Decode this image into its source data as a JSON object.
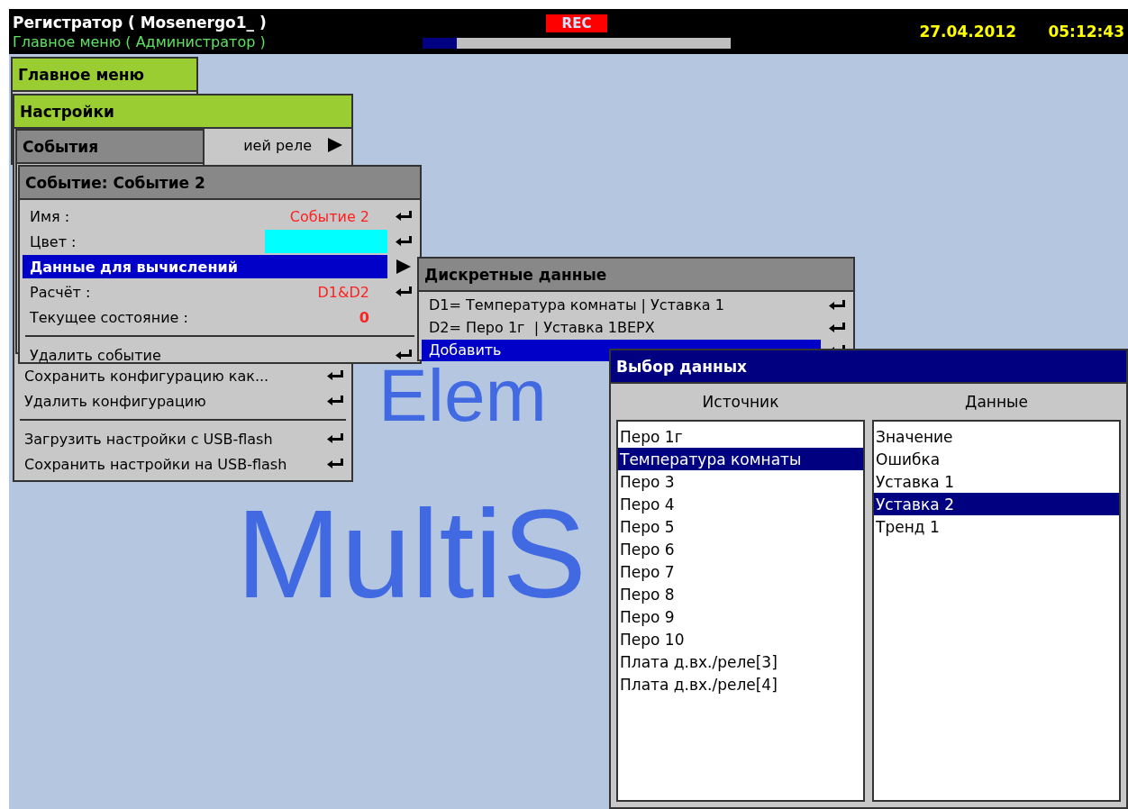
{
  "header": {
    "title": "Регистратор ( Mosenergo1_ )",
    "subtitle": "Главное меню ( Администратор )",
    "rec": "REC",
    "progress": {
      "level": 0.11
    },
    "date": "27.04.2012",
    "time": "05:12:43"
  },
  "logo": [
    "Elem",
    "MultiS"
  ],
  "main_menu": {
    "title": "Главное меню"
  },
  "settings_menu": {
    "title": "Настройки",
    "top_items": [
      {
        "kind": "submenu",
        "label": "ией реле"
      }
    ],
    "bottom_items": [
      {
        "kind": "action",
        "label": "Сохранить конфигурацию как..."
      },
      {
        "kind": "action",
        "label": "Удалить конфигурацию"
      },
      {
        "kind": "divider"
      },
      {
        "kind": "action",
        "label": "Загрузить настройки с USB-flash"
      },
      {
        "kind": "action",
        "label": "Сохранить настройки на USB-flash"
      }
    ]
  },
  "events_menu": {
    "title": "События"
  },
  "event_window": {
    "title": "Событие: Событие 2",
    "rows": [
      {
        "kind": "text",
        "label": "Имя :",
        "value": "Событие 2",
        "selected": false
      },
      {
        "kind": "color",
        "label": "Цвет :",
        "color": "#00ffff",
        "selected": false
      },
      {
        "kind": "submenu",
        "label": "Данные для вычислений",
        "selected": true
      },
      {
        "kind": "text",
        "label": "Расчёт :",
        "value": "D1&D2",
        "selected": false
      },
      {
        "kind": "status",
        "label": "Текущее состояние :",
        "value": "0",
        "selected": false
      },
      {
        "kind": "divider"
      },
      {
        "kind": "action",
        "label": "Удалить событие",
        "selected": false
      }
    ]
  },
  "discrete_window": {
    "title": "Дискретные данные",
    "rows": [
      {
        "label": "D1= Температура комнаты | Уставка 1",
        "selected": false
      },
      {
        "label": "D2= Перо 1г  | Уставка 1ВЕРХ",
        "selected": false
      },
      {
        "label": "Добавить",
        "selected": true
      }
    ]
  },
  "select_dialog": {
    "title": "Выбор данных",
    "columns": [
      {
        "heading": "Источник",
        "items": [
          {
            "label": "Перо 1г",
            "selected": false
          },
          {
            "label": "Температура комнаты",
            "selected": true
          },
          {
            "label": "Перо 3",
            "selected": false
          },
          {
            "label": "Перо 4",
            "selected": false
          },
          {
            "label": "Перо 5",
            "selected": false
          },
          {
            "label": "Перо 6",
            "selected": false
          },
          {
            "label": "Перо 7",
            "selected": false
          },
          {
            "label": "Перо 8",
            "selected": false
          },
          {
            "label": "Перо 9",
            "selected": false
          },
          {
            "label": "Перо 10",
            "selected": false
          },
          {
            "label": "Плата д.вх./реле[3]",
            "selected": false
          },
          {
            "label": "Плата д.вх./реле[4]",
            "selected": false
          }
        ]
      },
      {
        "heading": "Данные",
        "items": [
          {
            "label": "Значение",
            "selected": false
          },
          {
            "label": "Ошибка",
            "selected": false
          },
          {
            "label": "Уставка 1",
            "selected": false
          },
          {
            "label": "Уставка 2",
            "selected": true
          },
          {
            "label": "Тренд 1",
            "selected": false
          }
        ]
      }
    ]
  }
}
